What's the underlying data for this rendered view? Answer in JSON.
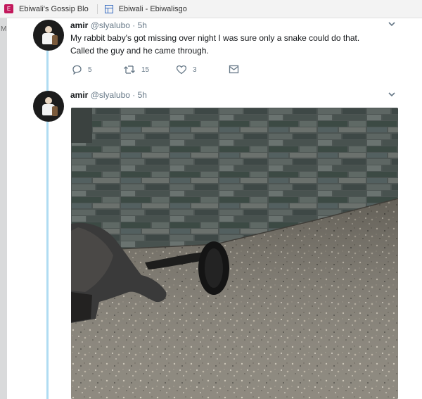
{
  "bookmarks": [
    {
      "label": "Ebiwali's Gossip Blo",
      "icon": "ebiwali-favicon"
    },
    {
      "label": "Ebiwali - Ebiwalisgo",
      "icon": "window-icon"
    }
  ],
  "left_strip_letter": "M",
  "tweets": [
    {
      "name": "amir",
      "handle": "@slyalubo",
      "time": "· 5h",
      "text_line1": "My rabbit baby's got missing over night I was sure only a snake could do that.",
      "text_line2": "Called the guy and he came through.",
      "replies": "5",
      "retweets": "15",
      "likes": "3"
    },
    {
      "name": "amir",
      "handle": "@slyalubo",
      "time": "· 5h"
    }
  ],
  "colors": {
    "thread_line": "#b0dcf2",
    "muted_text": "#657786",
    "primary_text": "#14171a"
  },
  "media": {
    "subject": "photo of a black snake (cobra) on a terrazzo floor beside a stone-tile wall, with a person at left"
  }
}
